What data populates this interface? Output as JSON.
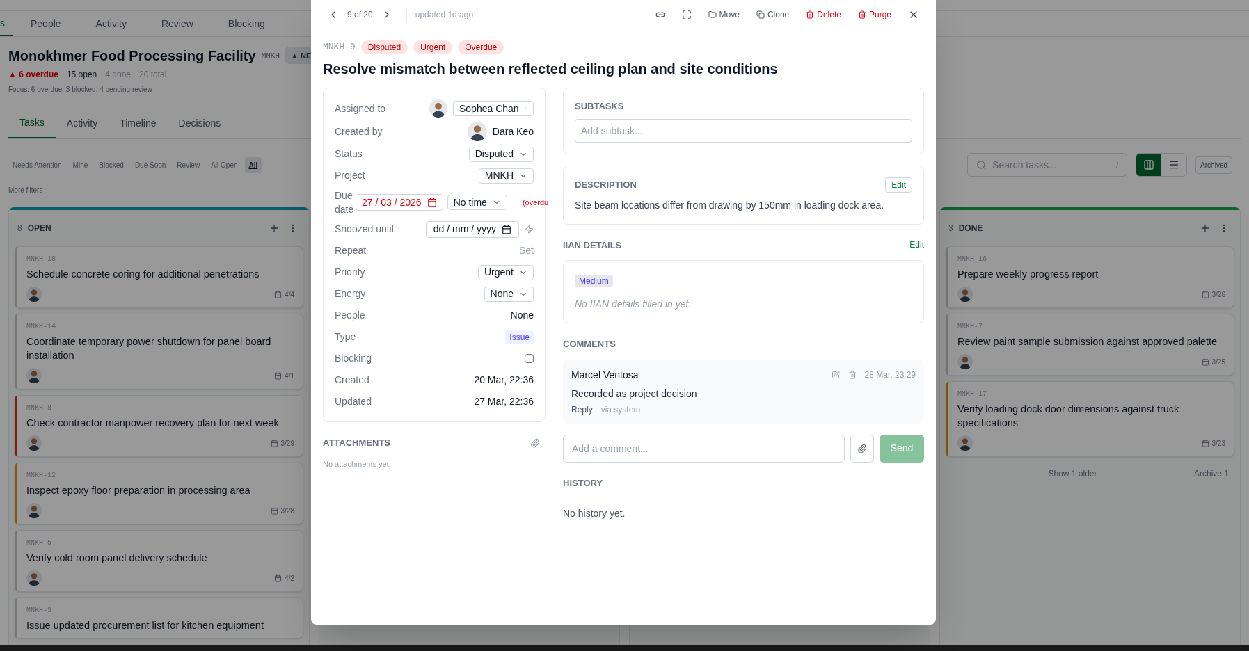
{
  "nav_tabs": [
    {
      "label": "s",
      "selected": true
    },
    {
      "label": "People",
      "selected": false
    },
    {
      "label": "Activity",
      "selected": false
    },
    {
      "label": "Review",
      "selected": false
    },
    {
      "label": "Blocking",
      "selected": false
    }
  ],
  "project": {
    "title": "Monokhmer Food Processing Facility",
    "code": "MNKH",
    "badge": "▲ NE",
    "overdue": "▲ 6 overdue",
    "open": "15 open",
    "done": "4 done",
    "total": "20 total",
    "focus": "Focus: 6 overdue, 3 blocked, 4 pending review"
  },
  "view_tabs": [
    {
      "label": "Tasks",
      "selected": true
    },
    {
      "label": "Activity",
      "selected": false
    },
    {
      "label": "Timeline",
      "selected": false
    },
    {
      "label": "Decisions",
      "selected": false
    }
  ],
  "filters": [
    {
      "label": "Needs Attention",
      "selected": false
    },
    {
      "label": "Mine",
      "selected": false
    },
    {
      "label": "Blocked",
      "selected": false
    },
    {
      "label": "Due Soon",
      "selected": false
    },
    {
      "label": "Review",
      "selected": false
    },
    {
      "label": "All Open",
      "selected": false
    },
    {
      "label": "All",
      "selected": true
    }
  ],
  "more_filters": "More filters",
  "search": {
    "placeholder": "Search tasks...",
    "shortcut": "/"
  },
  "view_toggle": [
    {
      "kind": "board",
      "selected": true
    },
    {
      "kind": "list",
      "selected": false
    }
  ],
  "archived_button": "Archived",
  "columns": [
    {
      "count": "8",
      "title": "OPEN",
      "color": "#085d6d",
      "cards": [
        {
          "id": "MNKH-18",
          "title": "Schedule concrete coring for additional penetrations",
          "due": "4/4",
          "color": "#767676"
        },
        {
          "id": "MNKH-14",
          "title": "Coordinate temporary power shutdown for panel board installation",
          "due": "4/1",
          "color": "#767676"
        },
        {
          "id": "MNKH-8",
          "title": "Check contractor manpower recovery plan for next week",
          "due": "3/29",
          "color": "#841717"
        },
        {
          "id": "MNKH-12",
          "title": "Inspect epoxy floor preparation in processing area",
          "due": "3/28",
          "color": "#7f5c04"
        },
        {
          "id": "MNKH-5",
          "title": "Verify cold room panel delivery schedule",
          "due": "4/2",
          "color": "#767676"
        },
        {
          "id": "MNKH-3",
          "title": "Issue updated procurement list for kitchen equipment",
          "color": "#767676"
        }
      ]
    },
    {
      "count": "3",
      "title": "DONE",
      "color": "#0d622c",
      "cards": [
        {
          "id": "MNKH-16",
          "title": "Prepare weekly progress report",
          "due": "3/26",
          "color": "#767676"
        },
        {
          "id": "MNKH-7",
          "title": "Review paint sample submission against approved palette",
          "due": "3/25",
          "color": "#767676"
        },
        {
          "id": "MNKH-17",
          "title": "Verify loading dock door dimensions against truck specifications",
          "due": "3/23",
          "color": "#7f5c04"
        }
      ],
      "show_older": "Show 1 older",
      "archive": "Archive 1"
    }
  ],
  "modal": {
    "position": "9 of 20",
    "updated": "updated 1d ago",
    "actions": [
      {
        "kind": "link"
      },
      {
        "kind": "expand"
      },
      {
        "kind": "move",
        "label": "Move"
      },
      {
        "kind": "clone",
        "label": "Clone"
      },
      {
        "kind": "delete",
        "label": "Delete"
      },
      {
        "kind": "purge",
        "label": "Purge"
      },
      {
        "kind": "close"
      }
    ],
    "task_id": "MNKH-9",
    "tags": [
      "Disputed",
      "Urgent",
      "Overdue"
    ],
    "title": "Resolve mismatch between reflected ceiling plan and site conditions",
    "fields": [
      {
        "kind": "assignee",
        "label": "Assigned to",
        "value": "Sophea Chan"
      },
      {
        "kind": "person",
        "label": "Created by",
        "value": "Dara Keo"
      },
      {
        "kind": "select",
        "label": "Status",
        "value": "Disputed"
      },
      {
        "kind": "select",
        "label": "Project",
        "value": "MNKH"
      },
      {
        "kind": "due",
        "label": "Due date",
        "value": "27 / 03 / 2026",
        "overdue": true,
        "time": "No time",
        "note": "(overdu"
      },
      {
        "kind": "date",
        "label": "Snoozed until",
        "value": "dd / mm / yyyy"
      },
      {
        "kind": "link",
        "label": "Repeat",
        "value": "Set"
      },
      {
        "kind": "select",
        "label": "Priority",
        "value": "Urgent"
      },
      {
        "kind": "select",
        "label": "Energy",
        "value": "None"
      },
      {
        "kind": "text",
        "label": "People",
        "value": "None"
      },
      {
        "kind": "tag",
        "label": "Type",
        "value": "Issue"
      },
      {
        "kind": "checkbox",
        "label": "Blocking",
        "checked": false
      },
      {
        "kind": "text",
        "label": "Created",
        "value": "20 Mar, 22:36"
      },
      {
        "kind": "text",
        "label": "Updated",
        "value": "27 Mar, 22:36"
      }
    ],
    "attachments": {
      "title": "ATTACHMENTS",
      "empty": "No attachments yet."
    },
    "subtasks": {
      "title": "SUBTASKS",
      "placeholder": "Add subtask..."
    },
    "description": {
      "title": "DESCRIPTION",
      "edit": "Edit",
      "text": "Site beam locations differ from drawing by 150mm in loading dock area."
    },
    "iian": {
      "title": "IIAN DETAILS",
      "edit": "Edit",
      "badge": "Medium",
      "empty": "No IIAN details filled in yet."
    },
    "comments": {
      "title": "COMMENTS",
      "items": [
        {
          "author": "Marcel Ventosa",
          "time": "28 Mar, 23:29",
          "text": "Recorded as project decision",
          "reply": "Reply",
          "source": "via system"
        }
      ],
      "placeholder": "Add a comment...",
      "send": "Send"
    },
    "history": {
      "title": "HISTORY",
      "empty": "No history yet."
    }
  }
}
